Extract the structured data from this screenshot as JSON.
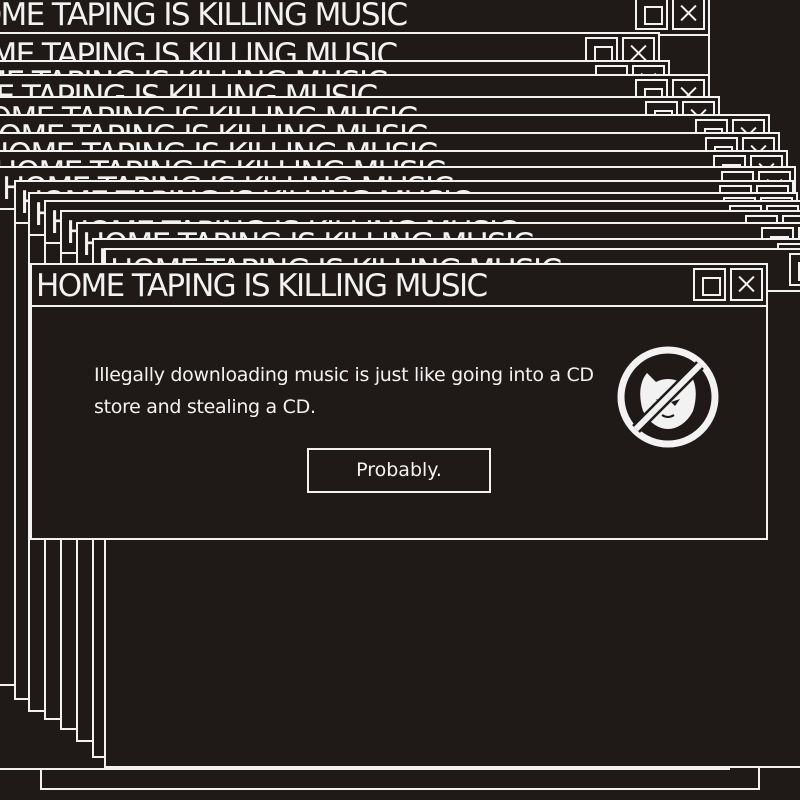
{
  "dialog": {
    "title": "HOME TAPING IS KILLING MUSIC",
    "message": "Illegally downloading music is just like going into a CD store and stealing a CD.",
    "button_label": "Probably.",
    "logo_icon": "crossed-out-cat-headphones-icon",
    "maximize_icon": "maximize-icon",
    "close_icon": "close-icon"
  },
  "theme": {
    "background": "#1f1a18",
    "foreground": "#f2f2f2"
  }
}
